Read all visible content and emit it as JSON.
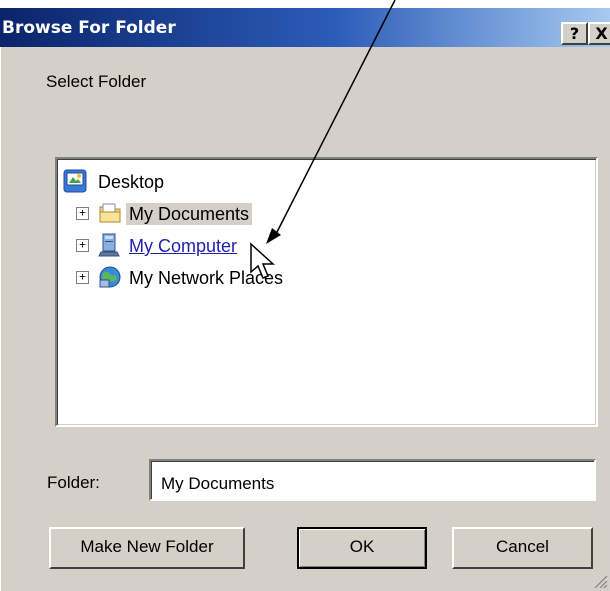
{
  "window": {
    "title": "Browse For Folder",
    "help_glyph": "?",
    "close_glyph": "X"
  },
  "instruction": "Select Folder",
  "tree": {
    "items": [
      {
        "label": "Desktop",
        "icon": "desktop-icon",
        "expander": ""
      },
      {
        "label": "My Documents",
        "icon": "folder-icon",
        "expander": "+"
      },
      {
        "label": "My Computer",
        "icon": "computer-icon",
        "expander": "+"
      },
      {
        "label": "My Network Places",
        "icon": "network-icon",
        "expander": "+"
      }
    ],
    "selected": "My Documents",
    "hovered": "My Computer"
  },
  "folder_field": {
    "label": "Folder:",
    "value": "My Documents"
  },
  "buttons": {
    "make_new_folder": "Make New Folder",
    "ok": "OK",
    "cancel": "Cancel"
  },
  "colors": {
    "title_bar_start": "#0a246a",
    "title_bar_end": "#a6caf0",
    "dialog_face": "#d4d0c8",
    "link_hover": "#1f1fb0"
  }
}
